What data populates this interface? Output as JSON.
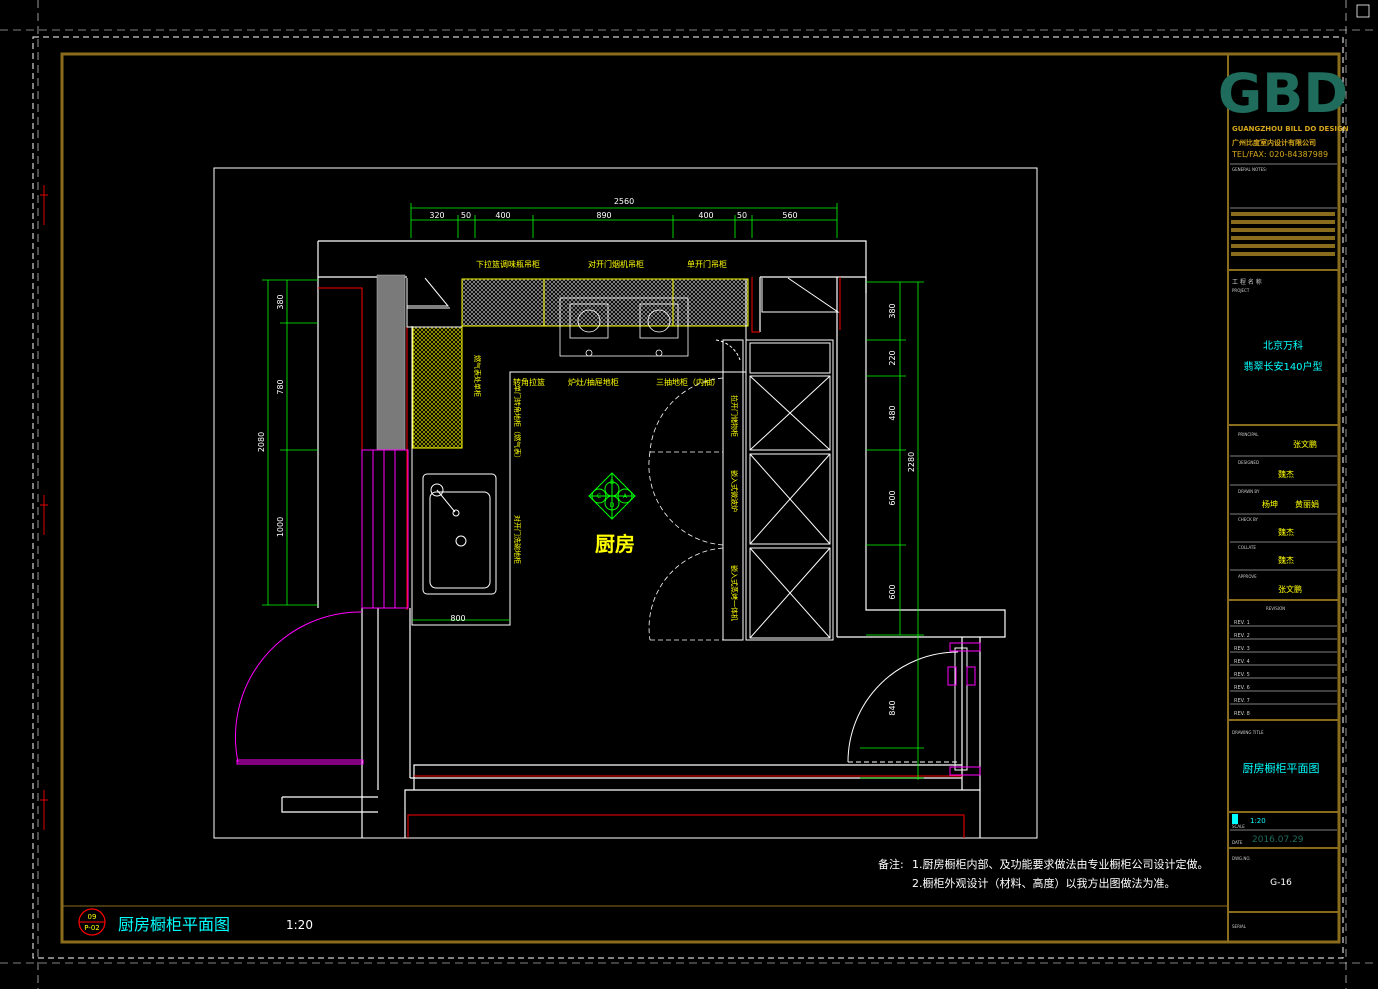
{
  "title_block": {
    "logo": "GBD",
    "company_en": "GUANGZHOU BILL DO DESIGN",
    "company_cn": "广州比度室内设计有限公司",
    "tel": "TEL/FAX: 020-84387989",
    "general_note_label": "GENERAL NOTES:",
    "project_label_cn": "工 程 名 称",
    "project_label_en": "PROJECT",
    "project_line1": "北京万科",
    "project_line2": "翡翠长安140户型",
    "principal_label": "PRINCIPAL",
    "principal_name": "张文鹏",
    "designed_label": "DESIGNED",
    "designed_name": "魏杰",
    "drawn_label": "DRAWN BY",
    "drawn_name_1": "杨坤",
    "drawn_name_2": "黄丽娟",
    "check_label": "CHECK BY",
    "check_name": "魏杰",
    "collate_label": "COLLATE",
    "collate_name": "魏杰",
    "approve_label": "APPROVE",
    "approve_name": "张文鹏",
    "revision_label": "REVISION",
    "revisions": [
      "REV. 1",
      "REV. 2",
      "REV. 3",
      "REV. 4",
      "REV. 5",
      "REV. 6",
      "REV. 7",
      "REV. 8"
    ],
    "drawing_title_label": "DRAWING TITLE",
    "drawing_title": "厨房橱柜平面图",
    "scale_label": "SCALE",
    "scale_value": "1:20",
    "date_label": "DATE",
    "date_value": "2016.07.29",
    "dwg_no_label": "DWG.NO.",
    "dwg_no": "G-16",
    "serial_label": "SERIAL"
  },
  "plan": {
    "room_label": "厨房",
    "index_letters": [
      "B",
      "C",
      "A",
      "D"
    ],
    "dim_top_total": "2560",
    "dims_top": [
      "320",
      "50",
      "400",
      "890",
      "400",
      "50",
      "560"
    ],
    "dims_left_total": "2080",
    "dims_left": [
      "380",
      "780",
      "1000"
    ],
    "dims_right_total": "2280",
    "dims_right": [
      "380",
      "220",
      "480",
      "600",
      "600"
    ],
    "dim_sink_width": "800",
    "dim_door": "840",
    "upper_labels": [
      "下拉篮调味瓶吊柜",
      "对开门烟机吊柜",
      "单开门吊柜"
    ],
    "lower_labels": [
      "转角拉篮",
      "炉灶/抽屉地柜",
      "三抽地柜（内抽）"
    ],
    "vertical_labels": [
      "燃气表处单柜",
      "单门转角地柜（燃气表）",
      "对开门洗碗地柜",
      "拉开门储物柜",
      "嵌入式微波炉",
      "嵌入式蒸烤一体机"
    ]
  },
  "notes": {
    "prefix": "备注:",
    "line1": "1.厨房橱柜内部、及功能要求做法由专业橱柜公司设计定做。",
    "line2": "2.橱柜外观设计（材料、高度）以我方出图做法为准。"
  },
  "title_bar": {
    "index_top": "09",
    "index_bottom": "P-02",
    "title": "厨房橱柜平面图",
    "scale": "1:20"
  },
  "colors": {
    "frame": "#8a6d1c",
    "wall": "#ffffff",
    "dimension": "#00ff00",
    "annotation": "#ffff00",
    "accent_magenta": "#ff00ff",
    "red_line": "#ff0000",
    "cyan_text": "#00ffff",
    "logo": "#1f6b5c"
  }
}
